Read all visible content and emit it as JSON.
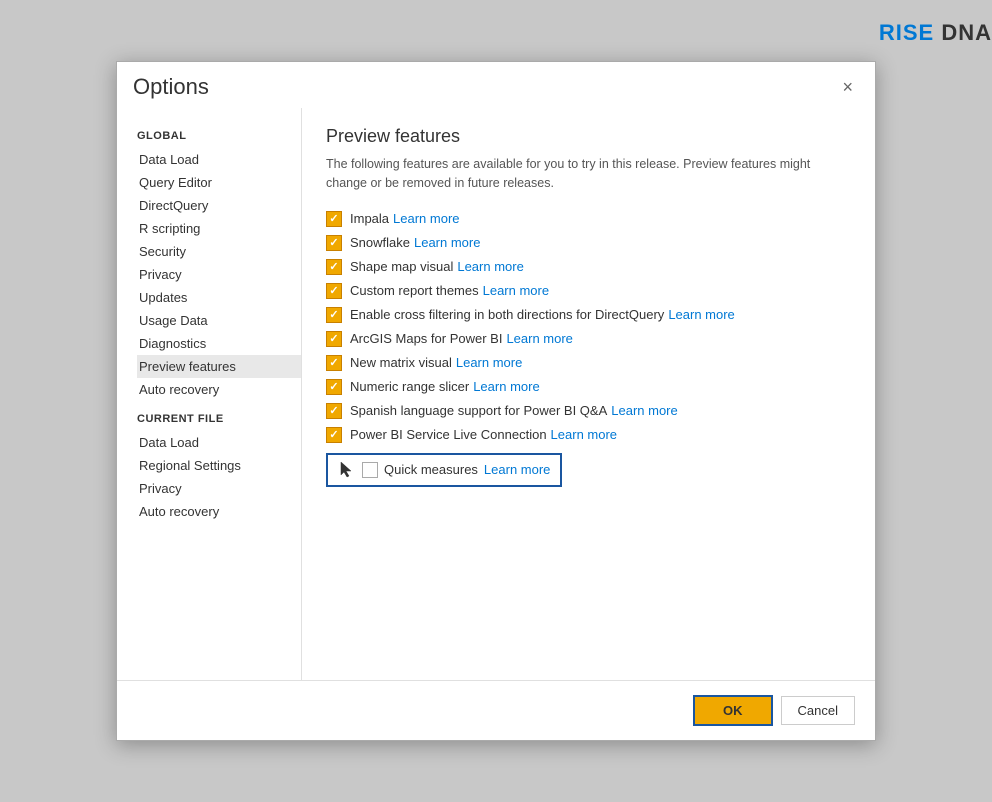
{
  "watermark": {
    "prefix": "RISE",
    "suffix": " DNA"
  },
  "dialog": {
    "title": "Options",
    "close_label": "×"
  },
  "sidebar": {
    "global_label": "GLOBAL",
    "global_items": [
      {
        "label": "Data Load",
        "id": "data-load"
      },
      {
        "label": "Query Editor",
        "id": "query-editor"
      },
      {
        "label": "DirectQuery",
        "id": "direct-query"
      },
      {
        "label": "R scripting",
        "id": "r-scripting"
      },
      {
        "label": "Security",
        "id": "security"
      },
      {
        "label": "Privacy",
        "id": "privacy"
      },
      {
        "label": "Updates",
        "id": "updates"
      },
      {
        "label": "Usage Data",
        "id": "usage-data"
      },
      {
        "label": "Diagnostics",
        "id": "diagnostics"
      },
      {
        "label": "Preview features",
        "id": "preview-features",
        "active": true
      },
      {
        "label": "Auto recovery",
        "id": "auto-recovery"
      }
    ],
    "current_file_label": "CURRENT FILE",
    "current_file_items": [
      {
        "label": "Data Load",
        "id": "cf-data-load"
      },
      {
        "label": "Regional Settings",
        "id": "cf-regional"
      },
      {
        "label": "Privacy",
        "id": "cf-privacy"
      },
      {
        "label": "Auto recovery",
        "id": "cf-auto-recovery"
      }
    ]
  },
  "content": {
    "title": "Preview features",
    "description": "The following features are available for you to try in this release. Preview features might change or be removed in future releases.",
    "features": [
      {
        "label": "Impala",
        "learn_more": "Learn more",
        "checked": true
      },
      {
        "label": "Snowflake",
        "learn_more": "Learn more",
        "checked": true
      },
      {
        "label": "Shape map visual",
        "learn_more": "Learn more",
        "checked": true
      },
      {
        "label": "Custom report themes",
        "learn_more": "Learn more",
        "checked": true
      },
      {
        "label": "Enable cross filtering in both directions for DirectQuery",
        "learn_more": "Learn more",
        "checked": true
      },
      {
        "label": "ArcGIS Maps for Power BI",
        "learn_more": "Learn more",
        "checked": true
      },
      {
        "label": "New matrix visual",
        "learn_more": "Learn more",
        "checked": true
      },
      {
        "label": "Numeric range slicer",
        "learn_more": "Learn more",
        "checked": true
      },
      {
        "label": "Spanish language support for Power BI Q&A",
        "learn_more": "Learn more",
        "checked": true
      },
      {
        "label": "Power BI Service Live Connection",
        "learn_more": "Learn more",
        "checked": true
      }
    ],
    "quick_measures": {
      "label": "Quick measures",
      "learn_more": "Learn more",
      "checked": false
    }
  },
  "footer": {
    "ok_label": "OK",
    "cancel_label": "Cancel"
  }
}
